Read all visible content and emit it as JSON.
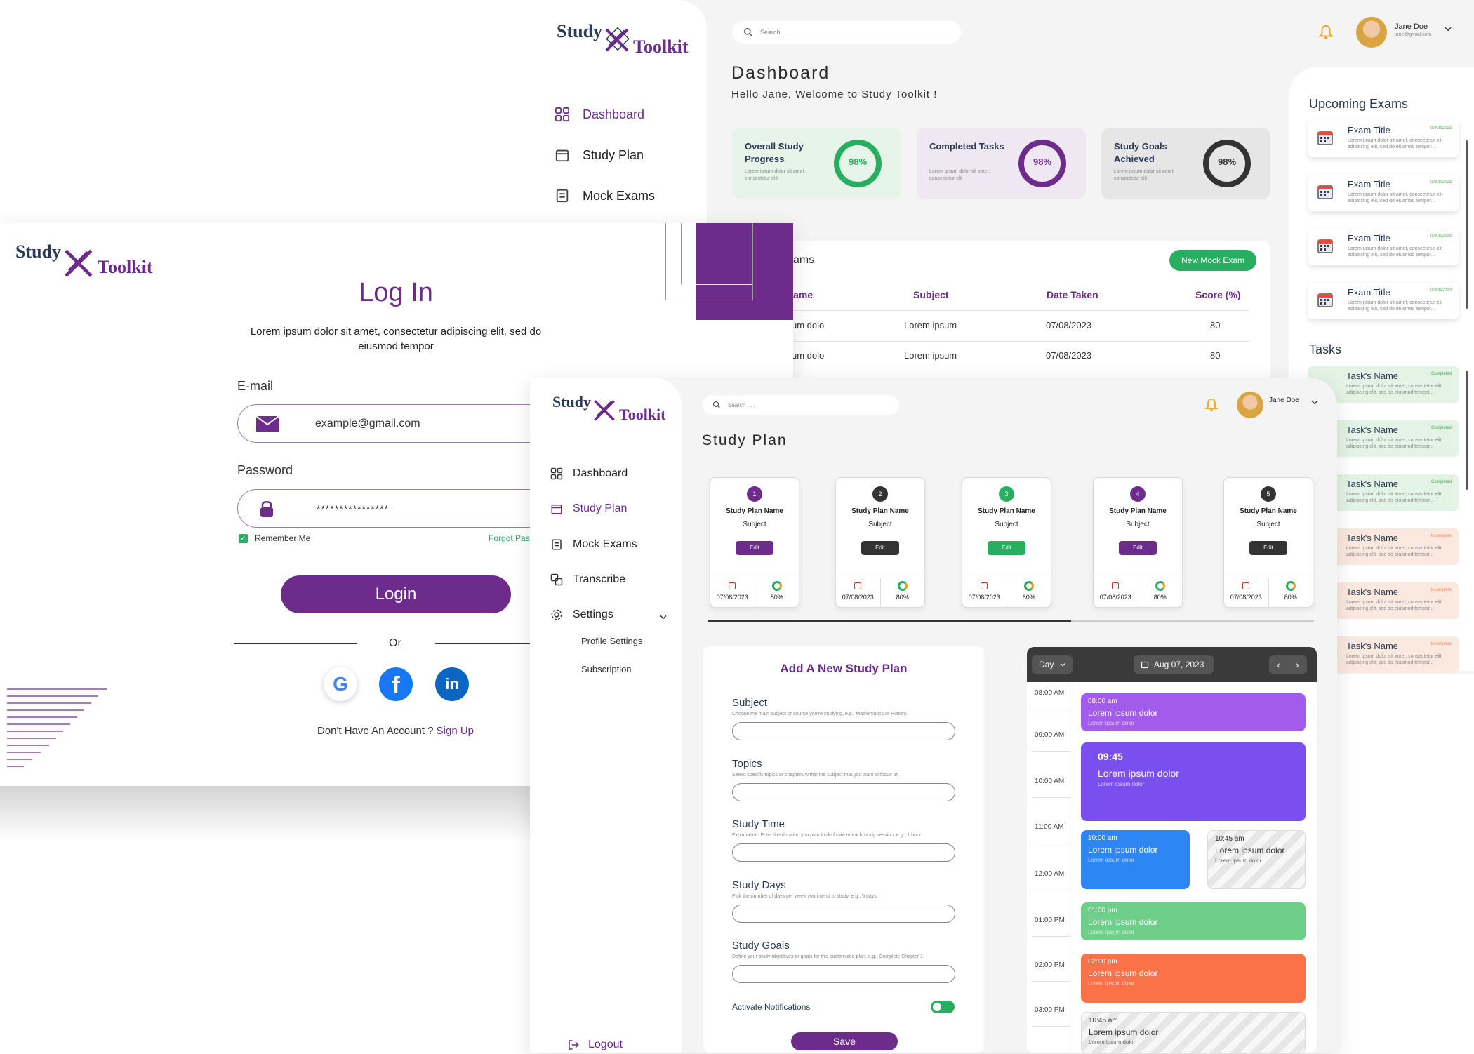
{
  "brand": {
    "word1": "Study",
    "word2": "Toolkit"
  },
  "login": {
    "title": "Log In",
    "subtitle": "Lorem ipsum dolor sit amet, consectetur adipiscing elit, sed do eiusmod tempor",
    "email_label": "E-mail",
    "email_value": "example@gmail.com",
    "password_label": "Password",
    "password_value": "****************",
    "remember": "Remember Me",
    "forgot": "Forgot Pas",
    "login_button": "Login",
    "or": "Or",
    "no_account": "Don't Have An Account ?",
    "signup": "Sign Up"
  },
  "dashboard": {
    "search_placeholder": "Search . . .",
    "user_name": "Jane Doe",
    "user_email": "jane@gmail.com",
    "title": "Dashboard",
    "welcome": "Hello Jane, Welcome to Study Toolkit !",
    "nav": [
      "Dashboard",
      "Study Plan",
      "Mock Exams"
    ],
    "stats": [
      {
        "title": "Overall Study Progress",
        "desc": "Lorem ipsum dolor sit amet, consectetur elit",
        "value": "98%",
        "pct": 98,
        "color": "#27ae60",
        "bg": "#e6f4ea"
      },
      {
        "title": "Completed Tasks",
        "desc": "Lorem ipsum dolor sit amet, consectetur elit",
        "value": "98%",
        "pct": 98,
        "color": "#6d2c8c",
        "bg": "#efe7f1"
      },
      {
        "title": "Study Goals Achieved",
        "desc": "Lorem ipsum dolor sit amet, consectetur elit",
        "value": "98%",
        "pct": 98,
        "color": "#333333",
        "bg": "#e6e6e6"
      }
    ],
    "exams_title": "ams",
    "new_exam_button": "New Mock Exam",
    "columns": [
      "Name",
      "Subject",
      "Date Taken",
      "Score (%)"
    ],
    "rows": [
      [
        "um dolo",
        "Lorem ipsum",
        "07/08/2023",
        "80"
      ],
      [
        "um dolo",
        "Lorem ipsum",
        "07/08/2023",
        "80"
      ]
    ],
    "upcoming_title": "Upcoming Exams",
    "exams": [
      {
        "title": "Exam Title",
        "date": "07/08/2023",
        "desc": "Lorem ipsum dolor sit amet, consectetur elit adipiscing elit, sed do eiusmod tempor..."
      },
      {
        "title": "Exam Title",
        "date": "07/08/2023",
        "desc": "Lorem ipsum dolor sit amet, consectetur elit adipiscing elit, sed do eiusmod tempor..."
      },
      {
        "title": "Exam Title",
        "date": "07/08/2023",
        "desc": "Lorem ipsum dolor sit amet, consectetur elit adipiscing elit, sed do eiusmod tempor..."
      },
      {
        "title": "Exam Title",
        "date": "07/08/2023",
        "desc": "Lorem ipsum dolor sit amet, consectetur elit adipiscing elit, sed do eiusmod tempor..."
      }
    ],
    "tasks_title": "Tasks",
    "tasks": [
      {
        "name": "Task's Name",
        "status": "Completed",
        "desc": "Lorem ipsum dolor sit amet, consectetur elit adipiscing elit, sed do eiusmod tempor...",
        "bg": "#e3f3e5",
        "color": "#4caf50"
      },
      {
        "name": "Task's Name",
        "status": "Completed",
        "desc": "Lorem ipsum dolor sit amet, consectetur elit adipiscing elit, sed do eiusmod tempor...",
        "bg": "#e3f3e5",
        "color": "#4caf50"
      },
      {
        "name": "Task's Name",
        "status": "Completed",
        "desc": "Lorem ipsum dolor sit amet, consectetur elit adipiscing elit, sed do eiusmod tempor...",
        "bg": "#e3f3e5",
        "color": "#4caf50"
      },
      {
        "name": "Task's Name",
        "status": "Incomplete",
        "desc": "Lorem ipsum dolor sit amet, consectetur elit adipiscing elit, sed do eiusmod tempor...",
        "bg": "#fbe9df",
        "color": "#f08a5d"
      },
      {
        "name": "Task's Name",
        "status": "Incomplete",
        "desc": "Lorem ipsum dolor sit amet, consectetur elit adipiscing elit, sed do eiusmod tempor...",
        "bg": "#fbe9df",
        "color": "#f08a5d"
      },
      {
        "name": "Task's Name",
        "status": "Incomplete",
        "desc": "Lorem ipsum dolor sit amet, consectetur elit adipiscing elit, sed do eiusmod tempor...",
        "bg": "#fbe9df",
        "color": "#f08a5d"
      }
    ]
  },
  "studyplan": {
    "search_placeholder": "Search . . .",
    "user_name": "Jane Doe",
    "title": "Study Plan",
    "nav": [
      "Dashboard",
      "Study Plan",
      "Mock Exams",
      "Transcribe",
      "Settings"
    ],
    "sub_nav": [
      "Profile Settings",
      "Subscription"
    ],
    "logout": "Logout",
    "cards": [
      {
        "num": "1",
        "name": "Study Plan Name",
        "subject": "Subject",
        "edit": "Edit",
        "date": "07/08/2023",
        "pct": "80%",
        "num_color": "#6d2c8c",
        "btn_color": "#6d2c8c"
      },
      {
        "num": "2",
        "name": "Study Plan Name",
        "subject": "Subject",
        "edit": "Edit",
        "date": "07/08/2023",
        "pct": "80%",
        "num_color": "#333333",
        "btn_color": "#333333"
      },
      {
        "num": "3",
        "name": "Study Plan Name",
        "subject": "Subject",
        "edit": "Edit",
        "date": "07/08/2023",
        "pct": "80%",
        "num_color": "#27ae60",
        "btn_color": "#27ae60"
      },
      {
        "num": "4",
        "name": "Study Plan Name",
        "subject": "Subject",
        "edit": "Edit",
        "date": "07/08/2023",
        "pct": "80%",
        "num_color": "#6d2c8c",
        "btn_color": "#6d2c8c"
      },
      {
        "num": "5",
        "name": "Study Plan Name",
        "subject": "Subject",
        "edit": "Edit",
        "date": "07/08/2023",
        "pct": "80%",
        "num_color": "#333333",
        "btn_color": "#333333"
      }
    ],
    "scroll_progress": 0.6,
    "form": {
      "title": "Add A New Study Plan",
      "fields": [
        {
          "label": "Subject",
          "desc": "Choose the main subject or course you're studying, e.g., Mathematics or History."
        },
        {
          "label": "Topics",
          "desc": "Select specific topics or chapters within the subject that you want to focus on."
        },
        {
          "label": "Study Time",
          "desc": "Explanation: Enter the duration you plan to dedicate to each study session, e.g., 1 hour."
        },
        {
          "label": "Study Days",
          "desc": "Pick the number of days per week you intend to study, e.g., 5 days."
        },
        {
          "label": "Study Goals",
          "desc": "Define your study objectives or goals for this customized plan, e.g., Complete Chapter 1."
        }
      ],
      "notifications": "Activate Notifications",
      "save": "Save"
    },
    "calendar": {
      "view": "Day",
      "date": "Aug 07, 2023",
      "times": [
        "08:00 AM",
        "09:00 AM",
        "10:00 AM",
        "11:00 AM",
        "12:00 AM",
        "01:00 PM",
        "02:00 PM",
        "03:00 PM"
      ],
      "events": [
        {
          "time": "08:00 am",
          "title": "Lorem ipsum dolor",
          "sub": "Lorem ipsum dolor",
          "color": "#a25bea"
        },
        {
          "time": "09:45",
          "title": "Lorem ipsum dolor",
          "sub": "Lorem ipsum dolor",
          "color": "#7b4ef0"
        },
        {
          "time": "10:00 am",
          "title": "Lorem ipsum dolor",
          "sub": "Lorem ipsum dolor",
          "color": "#2e86f5"
        },
        {
          "time": "10:45 am",
          "title": "Lorem ipsum dolor",
          "sub": "Lorem ipsum dolor",
          "color": "#f2f2f2"
        },
        {
          "time": "01:00 pm",
          "title": "Lorem ipsum dolor",
          "sub": "Lorem ipsum dolor",
          "color": "#6dcf8a"
        },
        {
          "time": "02:00 pm",
          "title": "Lorem ipsum dolor",
          "sub": "Lorem ipsum dolor",
          "color": "#fb7248"
        },
        {
          "time": "10:45 am",
          "title": "Lorem ipsum dolor",
          "sub": "Lorem ipsum dolor",
          "color": "#f2f2f2"
        }
      ]
    }
  }
}
